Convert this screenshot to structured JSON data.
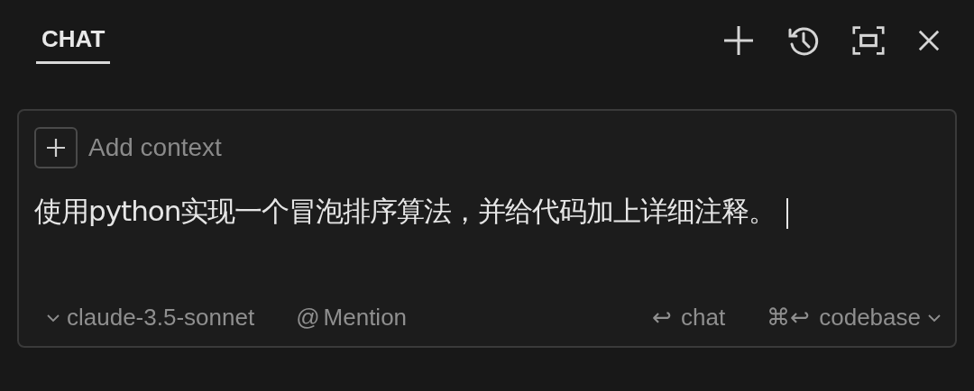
{
  "tabs": [
    {
      "label": "CHAT",
      "selected": true
    }
  ],
  "toolbar": [
    {
      "kind": "new"
    },
    {
      "kind": "history"
    },
    {
      "kind": "maximize"
    },
    {
      "kind": "close"
    }
  ],
  "composer": {
    "add_context": "Add context",
    "value": "使用python实现一个冒泡排序算法，并给代码加上详细注释。",
    "focused": true,
    "model": "claude-3.5-sonnet",
    "mention_symbol": "@",
    "mention": "Mention",
    "actions": [
      {
        "keys": "↩",
        "label": "chat",
        "dropdown": false
      },
      {
        "keys": "⌘↩",
        "label": "codebase",
        "dropdown": true
      }
    ]
  }
}
